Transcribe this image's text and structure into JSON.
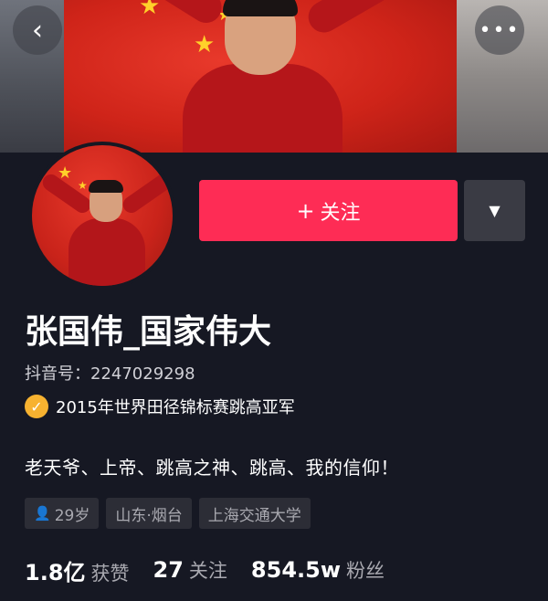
{
  "header": {
    "back_icon": "chevron-left-icon",
    "back_glyph": "‹",
    "more_icon": "ellipsis-icon",
    "more_glyph": "•••"
  },
  "profile": {
    "follow_label": "关注",
    "follow_plus": "+",
    "dropdown_glyph": "▼",
    "name": "张国伟_国家伟大",
    "douyin_id": "抖音号：2247029298",
    "verification": "2015年世界田径锦标赛跳高亚军",
    "verify_glyph": "✓",
    "bio": "老天爷、上帝、跳高之神、跳高、我的信仰！",
    "tags": [
      {
        "icon": "person-icon",
        "text": "29岁"
      },
      {
        "text": "山东·烟台"
      },
      {
        "text": "上海交通大学"
      }
    ]
  },
  "stats": [
    {
      "value": "1.8亿",
      "label": "获赞"
    },
    {
      "value": "27",
      "label": "关注"
    },
    {
      "value": "854.5w",
      "label": "粉丝"
    }
  ],
  "colors": {
    "background": "#161823",
    "follow_button": "#fe2c55",
    "verify_badge": "#f7b230",
    "tag_bg": "#2c2d36"
  }
}
